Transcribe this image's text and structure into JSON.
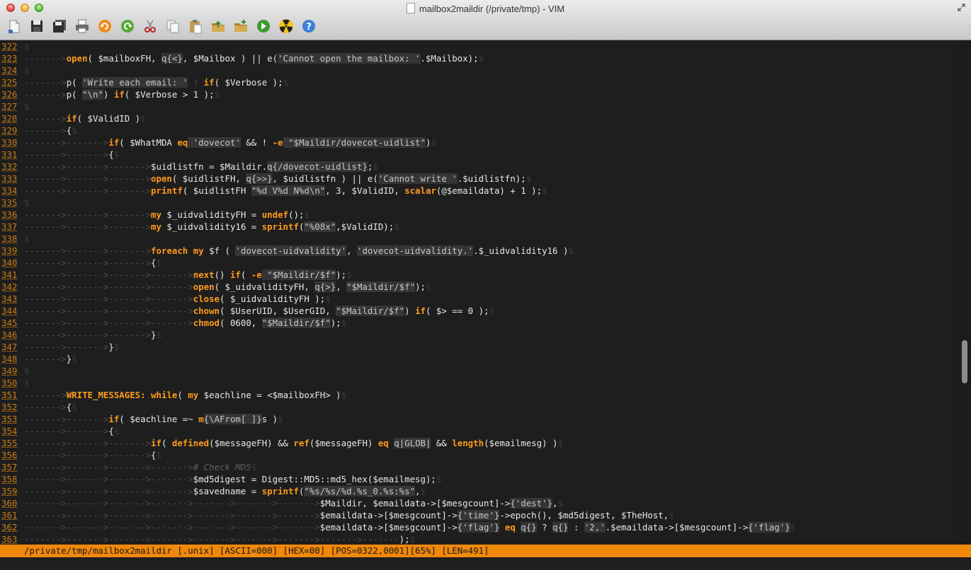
{
  "window": {
    "title": "mailbox2maildir (/private/tmp) - VIM"
  },
  "toolbar": {
    "buttons": [
      {
        "name": "open-icon",
        "label": "Open"
      },
      {
        "name": "save-icon",
        "label": "Save"
      },
      {
        "name": "save-all-icon",
        "label": "Save All"
      },
      {
        "name": "print-icon",
        "label": "Print"
      },
      {
        "name": "undo-icon",
        "label": "Undo"
      },
      {
        "name": "redo-icon",
        "label": "Redo"
      },
      {
        "name": "cut-icon",
        "label": "Cut"
      },
      {
        "name": "copy-icon",
        "label": "Copy"
      },
      {
        "name": "paste-icon",
        "label": "Paste"
      },
      {
        "name": "load-session-icon",
        "label": "Load Session"
      },
      {
        "name": "save-session-icon",
        "label": "Save Session"
      },
      {
        "name": "run-icon",
        "label": "Run"
      },
      {
        "name": "radiation-icon",
        "label": "Make"
      },
      {
        "name": "help-icon",
        "label": "Help"
      }
    ]
  },
  "colors": {
    "accent": "#f0880a",
    "keyword": "#ff9a1a",
    "line_number": "#c87d16",
    "background": "#1e1e1e"
  },
  "editor": {
    "lines": [
      {
        "n": "322",
        "tok": [
          [
            "e",
            "$"
          ]
        ]
      },
      {
        "n": "323",
        "tok": [
          [
            "t",
            "------->"
          ],
          [
            "k",
            "open"
          ],
          [
            "",
            "( $mailboxFH, "
          ],
          [
            "s",
            "q{<}"
          ],
          [
            "",
            ", $Mailbox ) || e("
          ],
          [
            "s",
            "'Cannot open the mailbox: '"
          ],
          [
            "",
            ".$Mailbox);"
          ],
          [
            "e",
            "$"
          ]
        ]
      },
      {
        "n": "324",
        "tok": [
          [
            "e",
            "$"
          ]
        ]
      },
      {
        "n": "325",
        "tok": [
          [
            "t",
            "------->"
          ],
          [
            "",
            "p( "
          ],
          [
            "s",
            "'Write each email: '"
          ],
          [
            "t",
            " ) "
          ],
          [
            "k",
            "if"
          ],
          [
            "",
            "( $Verbose );"
          ],
          [
            "e",
            "$"
          ]
        ]
      },
      {
        "n": "326",
        "tok": [
          [
            "t",
            "------->"
          ],
          [
            "",
            "p( "
          ],
          [
            "s",
            "\"\\n\""
          ],
          [
            "",
            ") "
          ],
          [
            "k",
            "if"
          ],
          [
            "",
            "( $Verbose > 1 );"
          ],
          [
            "e",
            "$"
          ]
        ]
      },
      {
        "n": "327",
        "tok": [
          [
            "e",
            "$"
          ]
        ]
      },
      {
        "n": "328",
        "tok": [
          [
            "t",
            "------->"
          ],
          [
            "k",
            "if"
          ],
          [
            "",
            "( $ValidID )"
          ],
          [
            "e",
            "$"
          ]
        ]
      },
      {
        "n": "329",
        "tok": [
          [
            "t",
            "------->"
          ],
          [
            "",
            "{"
          ],
          [
            "e",
            "$"
          ]
        ]
      },
      {
        "n": "330",
        "tok": [
          [
            "t",
            "------->------->"
          ],
          [
            "k",
            "if"
          ],
          [
            "",
            "( $WhatMDA "
          ],
          [
            "k",
            "eq"
          ],
          [
            "s",
            " 'dovecot'"
          ],
          [
            "",
            "",
            " && ! "
          ],
          [
            "k",
            "-e"
          ],
          [
            "s",
            " \"$Maildir/dovecot-uidlist\""
          ],
          [
            "",
            ")"
          ],
          [
            "e",
            "$"
          ]
        ]
      },
      {
        "n": "331",
        "tok": [
          [
            "t",
            "------->------->"
          ],
          [
            "",
            "{"
          ],
          [
            "e",
            "$"
          ]
        ]
      },
      {
        "n": "332",
        "tok": [
          [
            "t",
            "------->------->------->"
          ],
          [
            "",
            "$uidlistfn = $Maildir."
          ],
          [
            "s",
            "q{/dovecot-uidlist}"
          ],
          [
            "",
            ";"
          ],
          [
            "e",
            "$"
          ]
        ]
      },
      {
        "n": "333",
        "tok": [
          [
            "t",
            "------->------->------->"
          ],
          [
            "k",
            "open"
          ],
          [
            "",
            "( $uidlistFH, "
          ],
          [
            "s",
            "q{>>}"
          ],
          [
            "",
            ", $uidlistfn ) || e("
          ],
          [
            "s",
            "'Cannot write '"
          ],
          [
            "",
            ".$uidlistfn);"
          ],
          [
            "e",
            "$"
          ]
        ]
      },
      {
        "n": "334",
        "tok": [
          [
            "t",
            "------->------->------->"
          ],
          [
            "k",
            "printf"
          ],
          [
            "",
            "( $uidlistFH "
          ],
          [
            "s",
            "\"%d V%d N%d\\n\""
          ],
          [
            "",
            ", 3, $ValidID, "
          ],
          [
            "k",
            "scalar"
          ],
          [
            "",
            "(@$emaildata) + 1 );"
          ],
          [
            "e",
            "$"
          ]
        ]
      },
      {
        "n": "335",
        "tok": [
          [
            "e",
            "$"
          ]
        ]
      },
      {
        "n": "336",
        "tok": [
          [
            "t",
            "------->------->------->"
          ],
          [
            "k",
            "my"
          ],
          [
            "",
            "",
            " $_uidvalidityFH = "
          ],
          [
            "k",
            "undef"
          ],
          [
            "",
            "();"
          ],
          [
            "e",
            "$"
          ]
        ]
      },
      {
        "n": "337",
        "tok": [
          [
            "t",
            "------->------->------->"
          ],
          [
            "k",
            "my"
          ],
          [
            "",
            "",
            " $_uidvalidity16 = "
          ],
          [
            "k",
            "sprintf"
          ],
          [
            "",
            "("
          ],
          [
            "s",
            "\"%08x\""
          ],
          [
            "",
            ",$ValidID);"
          ],
          [
            "e",
            "$"
          ]
        ]
      },
      {
        "n": "338",
        "tok": [
          [
            "e",
            "$"
          ]
        ]
      },
      {
        "n": "339",
        "tok": [
          [
            "t",
            "------->------->------->"
          ],
          [
            "k",
            "foreach"
          ],
          [
            "",
            "",
            " "
          ],
          [
            "k",
            "my"
          ],
          [
            "",
            "",
            " $f ( "
          ],
          [
            "s",
            "'dovecot-uidvalidity'"
          ],
          [
            "",
            ", "
          ],
          [
            "s",
            "'dovecot-uidvalidity.'"
          ],
          [
            "",
            ".$_uidvalidity16 )"
          ],
          [
            "e",
            "$"
          ]
        ]
      },
      {
        "n": "340",
        "tok": [
          [
            "t",
            "------->------->------->"
          ],
          [
            "",
            "{"
          ],
          [
            "e",
            "$"
          ]
        ]
      },
      {
        "n": "341",
        "tok": [
          [
            "t",
            "------->------->------->------->"
          ],
          [
            "k",
            "next"
          ],
          [
            "",
            "() "
          ],
          [
            "k",
            "if"
          ],
          [
            "",
            "( "
          ],
          [
            "k",
            "-e"
          ],
          [
            "s",
            " \"$Maildir/$f\""
          ],
          [
            "",
            ");"
          ],
          [
            "e",
            "$"
          ]
        ]
      },
      {
        "n": "342",
        "tok": [
          [
            "t",
            "------->------->------->------->"
          ],
          [
            "k",
            "open"
          ],
          [
            "",
            "( $_uidvalidityFH, "
          ],
          [
            "s",
            "q{>}"
          ],
          [
            "",
            ", "
          ],
          [
            "s",
            "\"$Maildir/$f\""
          ],
          [
            "",
            ");"
          ],
          [
            "e",
            "$"
          ]
        ]
      },
      {
        "n": "343",
        "tok": [
          [
            "t",
            "------->------->------->------->"
          ],
          [
            "k",
            "close"
          ],
          [
            "",
            "( $_uidvalidityFH );"
          ],
          [
            "e",
            "$"
          ]
        ]
      },
      {
        "n": "344",
        "tok": [
          [
            "t",
            "------->------->------->------->"
          ],
          [
            "k",
            "chown"
          ],
          [
            "",
            "( $UserUID, $UserGID, "
          ],
          [
            "s",
            "\"$Maildir/$f\""
          ],
          [
            "",
            ") "
          ],
          [
            "k",
            "if"
          ],
          [
            "",
            "( $> == 0 );"
          ],
          [
            "e",
            "$"
          ]
        ]
      },
      {
        "n": "345",
        "tok": [
          [
            "t",
            "------->------->------->------->"
          ],
          [
            "k",
            "chmod"
          ],
          [
            "",
            "( 0600, "
          ],
          [
            "s",
            "\"$Maildir/$f\""
          ],
          [
            "",
            ");"
          ],
          [
            "e",
            "$"
          ]
        ]
      },
      {
        "n": "346",
        "tok": [
          [
            "t",
            "------->------->------->"
          ],
          [
            "",
            "}"
          ],
          [
            "e",
            "$"
          ]
        ]
      },
      {
        "n": "347",
        "tok": [
          [
            "t",
            "------->------->"
          ],
          [
            "",
            "}"
          ],
          [
            "e",
            "$"
          ]
        ]
      },
      {
        "n": "348",
        "tok": [
          [
            "t",
            "------->"
          ],
          [
            "",
            "}"
          ],
          [
            "e",
            "$"
          ]
        ]
      },
      {
        "n": "349",
        "tok": [
          [
            "e",
            "$"
          ]
        ]
      },
      {
        "n": "350",
        "tok": [
          [
            "e",
            "$"
          ]
        ]
      },
      {
        "n": "351",
        "tok": [
          [
            "t",
            "------->"
          ],
          [
            "k",
            "WRITE_MESSAGES:"
          ],
          [
            "",
            "",
            " "
          ],
          [
            "k",
            "while"
          ],
          [
            "",
            "( "
          ],
          [
            "k",
            "my"
          ],
          [
            "",
            "",
            " $eachline = <$mailboxFH> )"
          ],
          [
            "e",
            "$"
          ]
        ]
      },
      {
        "n": "352",
        "tok": [
          [
            "t",
            "------->"
          ],
          [
            "",
            "{"
          ],
          [
            "e",
            "$"
          ]
        ]
      },
      {
        "n": "353",
        "tok": [
          [
            "t",
            "------->------->"
          ],
          [
            "k",
            "if"
          ],
          [
            "",
            "( $eachline =~ "
          ],
          [
            "k",
            "m"
          ],
          [
            "s",
            "{\\AFrom[ ]}"
          ],
          [
            "",
            "s )"
          ],
          [
            "e",
            "$"
          ]
        ]
      },
      {
        "n": "354",
        "tok": [
          [
            "t",
            "------->------->"
          ],
          [
            "",
            "{"
          ],
          [
            "e",
            "$"
          ]
        ]
      },
      {
        "n": "355",
        "tok": [
          [
            "t",
            "------->------->------->"
          ],
          [
            "k",
            "if"
          ],
          [
            "",
            "( "
          ],
          [
            "k",
            "defined"
          ],
          [
            "",
            "($messageFH) && "
          ],
          [
            "k",
            "ref"
          ],
          [
            "",
            "($messageFH) "
          ],
          [
            "k",
            "eq"
          ],
          [
            "",
            "",
            " "
          ],
          [
            "s",
            "q|GLOB|"
          ],
          [
            "",
            "",
            " && "
          ],
          [
            "k",
            "length"
          ],
          [
            "",
            "($emailmesg) )"
          ],
          [
            "e",
            "$"
          ]
        ]
      },
      {
        "n": "356",
        "tok": [
          [
            "t",
            "------->------->------->"
          ],
          [
            "",
            "{"
          ],
          [
            "e",
            "$"
          ]
        ]
      },
      {
        "n": "357",
        "tok": [
          [
            "t",
            "------->------->------->------->"
          ],
          [
            "cm",
            "# Check MD5"
          ],
          [
            "e",
            "$"
          ]
        ]
      },
      {
        "n": "358",
        "tok": [
          [
            "t",
            "------->------->------->------->"
          ],
          [
            "",
            "$md5digest = Digest::MD5::md5_hex($emailmesg);"
          ],
          [
            "e",
            "$"
          ]
        ]
      },
      {
        "n": "359",
        "tok": [
          [
            "t",
            "------->------->------->------->"
          ],
          [
            "",
            "$savedname = "
          ],
          [
            "k",
            "sprintf"
          ],
          [
            "",
            "("
          ],
          [
            "s",
            "\"%s/%s/%d.%s_0.%s:%s\""
          ],
          [
            "",
            ","
          ],
          [
            "e",
            "$"
          ]
        ]
      },
      {
        "n": "360",
        "tok": [
          [
            "t",
            "------->------->------->------->------->------->------->"
          ],
          [
            "",
            "$Maildir, $emaildata->[$mesgcount]->"
          ],
          [
            "s",
            "{'dest'}"
          ],
          [
            "",
            ","
          ],
          [
            "e",
            "$"
          ]
        ]
      },
      {
        "n": "361",
        "tok": [
          [
            "t",
            "------->------->------->------->------->------->------->"
          ],
          [
            "",
            "$emaildata->[$mesgcount]->"
          ],
          [
            "s",
            "{'time'}"
          ],
          [
            "",
            "->epoch(), $md5digest, $TheHost,"
          ],
          [
            "e",
            "$"
          ]
        ]
      },
      {
        "n": "362",
        "tok": [
          [
            "t",
            "------->------->------->------->------->------->------->"
          ],
          [
            "",
            "$emaildata->[$mesgcount]->"
          ],
          [
            "s",
            "{'flag'}"
          ],
          [
            "",
            "",
            " "
          ],
          [
            "k",
            "eq"
          ],
          [
            "",
            "",
            " "
          ],
          [
            "s",
            "q{}"
          ],
          [
            "",
            "",
            " ? "
          ],
          [
            "s",
            "q{}"
          ],
          [
            "",
            "",
            " : "
          ],
          [
            "s",
            "'2,'"
          ],
          [
            "",
            ".$emaildata->[$mesgcount]->"
          ],
          [
            "s",
            "{'flag'}"
          ],
          [
            "e",
            "$"
          ]
        ]
      },
      {
        "n": "363",
        "tok": [
          [
            "t",
            "------->------->------->------->------->------->------->------->-------"
          ],
          [
            "",
            ");"
          ],
          [
            "e",
            "$"
          ]
        ]
      }
    ]
  },
  "statusline": {
    "text": "/private/tmp/mailbox2maildir [.unix] [ASCII=000] [HEX=00] [POS=0322,0001][65%] [LEN=491]"
  },
  "scrollbar": {
    "position_fraction": 0.65,
    "visible_fraction": 0.085
  }
}
